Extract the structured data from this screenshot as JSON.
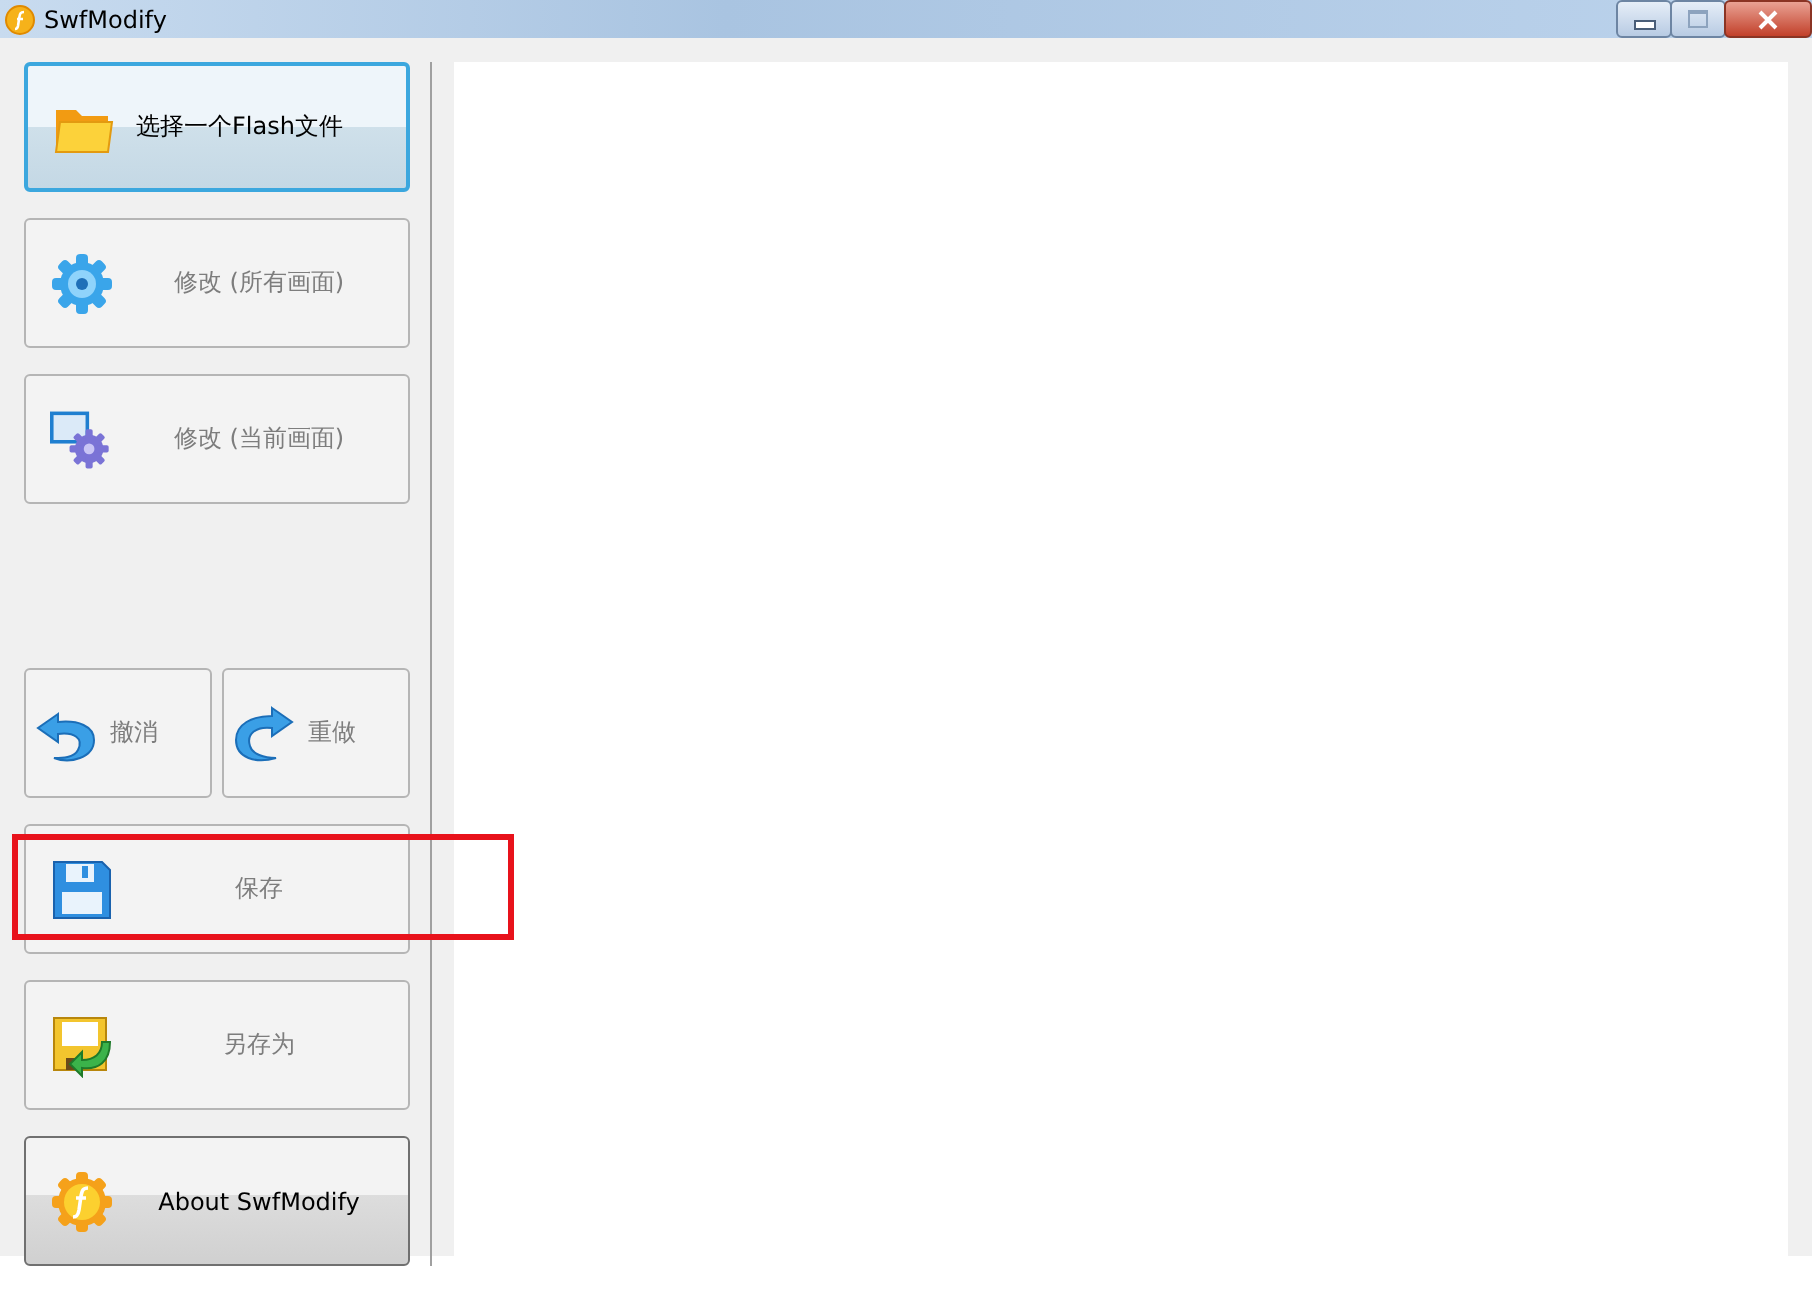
{
  "window": {
    "title": "SwfModify"
  },
  "buttons": [
    {
      "label": "选择一个Flash文件",
      "kind": "folder",
      "disabled": false,
      "highlighted": false
    },
    {
      "label": "修改 (所有画面)",
      "kind": "gear",
      "disabled": true,
      "highlighted": false
    },
    {
      "label": "修改 (当前画面)",
      "kind": "screen-gear",
      "disabled": true,
      "highlighted": false
    },
    {
      "label": "撤消",
      "kind": "undo",
      "disabled": true,
      "highlighted": false
    },
    {
      "label": "重做",
      "kind": "redo",
      "disabled": true,
      "highlighted": false
    },
    {
      "label": "保存",
      "kind": "save",
      "disabled": true,
      "highlighted": true
    },
    {
      "label": "另存为",
      "kind": "save-as",
      "disabled": true,
      "highlighted": false
    },
    {
      "label": "About SwfModify",
      "kind": "about",
      "disabled": false,
      "highlighted": false
    }
  ]
}
